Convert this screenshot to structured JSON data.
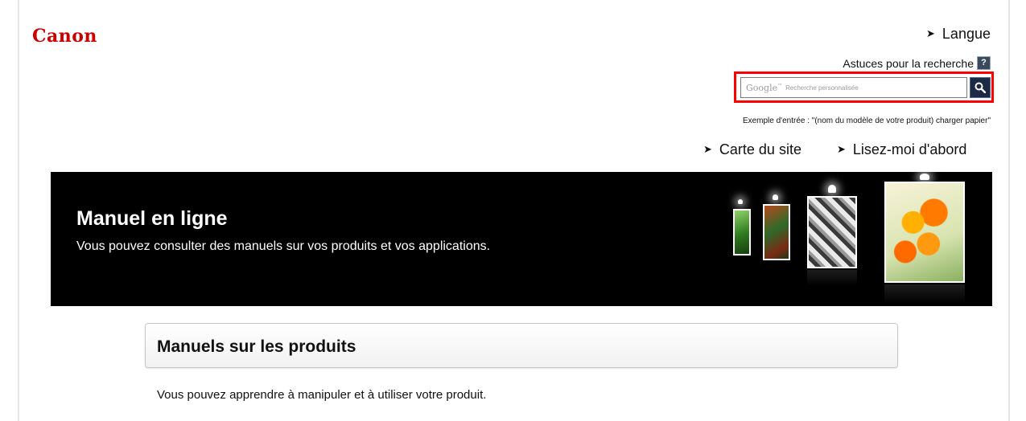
{
  "header": {
    "logo_text": "Canon",
    "language_link": "Langue",
    "search_tips": "Astuces pour la recherche",
    "help_icon_text": "?",
    "search": {
      "google_label": "Google",
      "google_tm": "™",
      "placeholder": "Recherche personnalisée"
    },
    "example": "Exemple d'entrée : \"(nom du modèle de votre produit) charger papier\"",
    "links": {
      "sitemap": "Carte du site",
      "readme": "Lisez-moi d'abord"
    }
  },
  "banner": {
    "title": "Manuel en ligne",
    "subtitle": "Vous pouvez consulter des manuels sur vos produits et vos applications."
  },
  "section": {
    "title": "Manuels sur les produits",
    "description": "Vous pouvez apprendre à manipuler et à utiliser votre produit."
  },
  "colors": {
    "brand": "#cc0000",
    "highlight": "#ff0000",
    "search_button": "#1d2a45"
  },
  "icons": {
    "nav_arrow": "arrow-right-icon",
    "help": "question-icon",
    "search": "magnifier-icon"
  }
}
